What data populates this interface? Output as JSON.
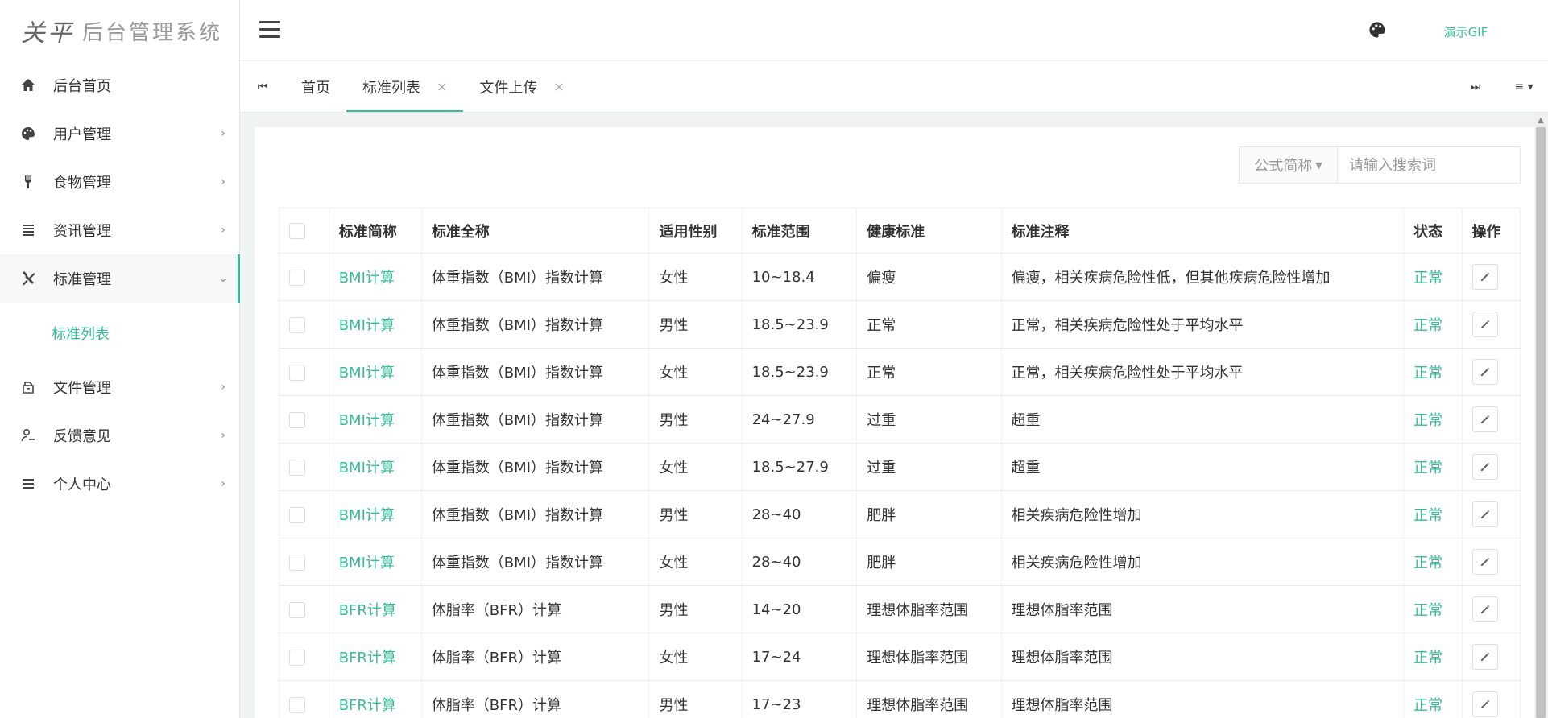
{
  "app": {
    "logo_mark": "关平",
    "title": "后台管理系统"
  },
  "header": {
    "user_text": "演示GIF"
  },
  "sidebar": {
    "items": [
      {
        "label": "后台首页",
        "icon": "home-icon",
        "has_chevron": false
      },
      {
        "label": "用户管理",
        "icon": "palette-icon",
        "has_chevron": true
      },
      {
        "label": "食物管理",
        "icon": "fork-icon",
        "has_chevron": true
      },
      {
        "label": "资讯管理",
        "icon": "list-icon",
        "has_chevron": true
      },
      {
        "label": "标准管理",
        "icon": "tools-icon",
        "has_chevron": true,
        "expanded": true
      },
      {
        "label": "文件管理",
        "icon": "archive-icon",
        "has_chevron": true
      },
      {
        "label": "反馈意见",
        "icon": "user-edit-icon",
        "has_chevron": true
      },
      {
        "label": "个人中心",
        "icon": "menu-icon",
        "has_chevron": true
      }
    ],
    "sub_items": [
      {
        "label": "标准列表"
      }
    ]
  },
  "tabs": [
    {
      "label": "首页",
      "closable": false,
      "active": false
    },
    {
      "label": "标准列表",
      "closable": true,
      "active": true
    },
    {
      "label": "文件上传",
      "closable": true,
      "active": false
    }
  ],
  "tab_close_glyph": "×",
  "search": {
    "dropdown_label": "公式简称",
    "placeholder": "请输入搜索词"
  },
  "table": {
    "columns": [
      "标准简称",
      "标准全称",
      "适用性别",
      "标准范围",
      "健康标准",
      "标准注释",
      "状态",
      "操作"
    ],
    "rows": [
      {
        "short": "BMI计算",
        "full": "体重指数（BMI）指数计算",
        "gender": "女性",
        "range": "10~18.4",
        "health": "偏瘦",
        "note": "偏瘦，相关疾病危险性低，但其他疾病危险性增加",
        "status": "正常"
      },
      {
        "short": "BMI计算",
        "full": "体重指数（BMI）指数计算",
        "gender": "男性",
        "range": "18.5~23.9",
        "health": "正常",
        "note": "正常，相关疾病危险性处于平均水平",
        "status": "正常"
      },
      {
        "short": "BMI计算",
        "full": "体重指数（BMI）指数计算",
        "gender": "女性",
        "range": "18.5~23.9",
        "health": "正常",
        "note": "正常，相关疾病危险性处于平均水平",
        "status": "正常"
      },
      {
        "short": "BMI计算",
        "full": "体重指数（BMI）指数计算",
        "gender": "男性",
        "range": "24~27.9",
        "health": "过重",
        "note": "超重",
        "status": "正常"
      },
      {
        "short": "BMI计算",
        "full": "体重指数（BMI）指数计算",
        "gender": "女性",
        "range": "18.5~27.9",
        "health": "过重",
        "note": "超重",
        "status": "正常"
      },
      {
        "short": "BMI计算",
        "full": "体重指数（BMI）指数计算",
        "gender": "男性",
        "range": "28~40",
        "health": "肥胖",
        "note": "相关疾病危险性增加",
        "status": "正常"
      },
      {
        "short": "BMI计算",
        "full": "体重指数（BMI）指数计算",
        "gender": "女性",
        "range": "28~40",
        "health": "肥胖",
        "note": "相关疾病危险性增加",
        "status": "正常"
      },
      {
        "short": "BFR计算",
        "full": "体脂率（BFR）计算",
        "gender": "男性",
        "range": "14~20",
        "health": "理想体脂率范围",
        "note": "理想体脂率范围",
        "status": "正常"
      },
      {
        "short": "BFR计算",
        "full": "体脂率（BFR）计算",
        "gender": "女性",
        "range": "17~24",
        "health": "理想体脂率范围",
        "note": "理想体脂率范围",
        "status": "正常"
      },
      {
        "short": "BFR计算",
        "full": "体脂率（BFR）计算",
        "gender": "男性",
        "range": "17~23",
        "health": "理想体脂率范围",
        "note": "理想体脂率范围",
        "status": "正常"
      }
    ]
  },
  "colors": {
    "accent": "#36bc9b",
    "sidebar_bg": "#ffffff",
    "page_bg": "#f0f3f4"
  }
}
